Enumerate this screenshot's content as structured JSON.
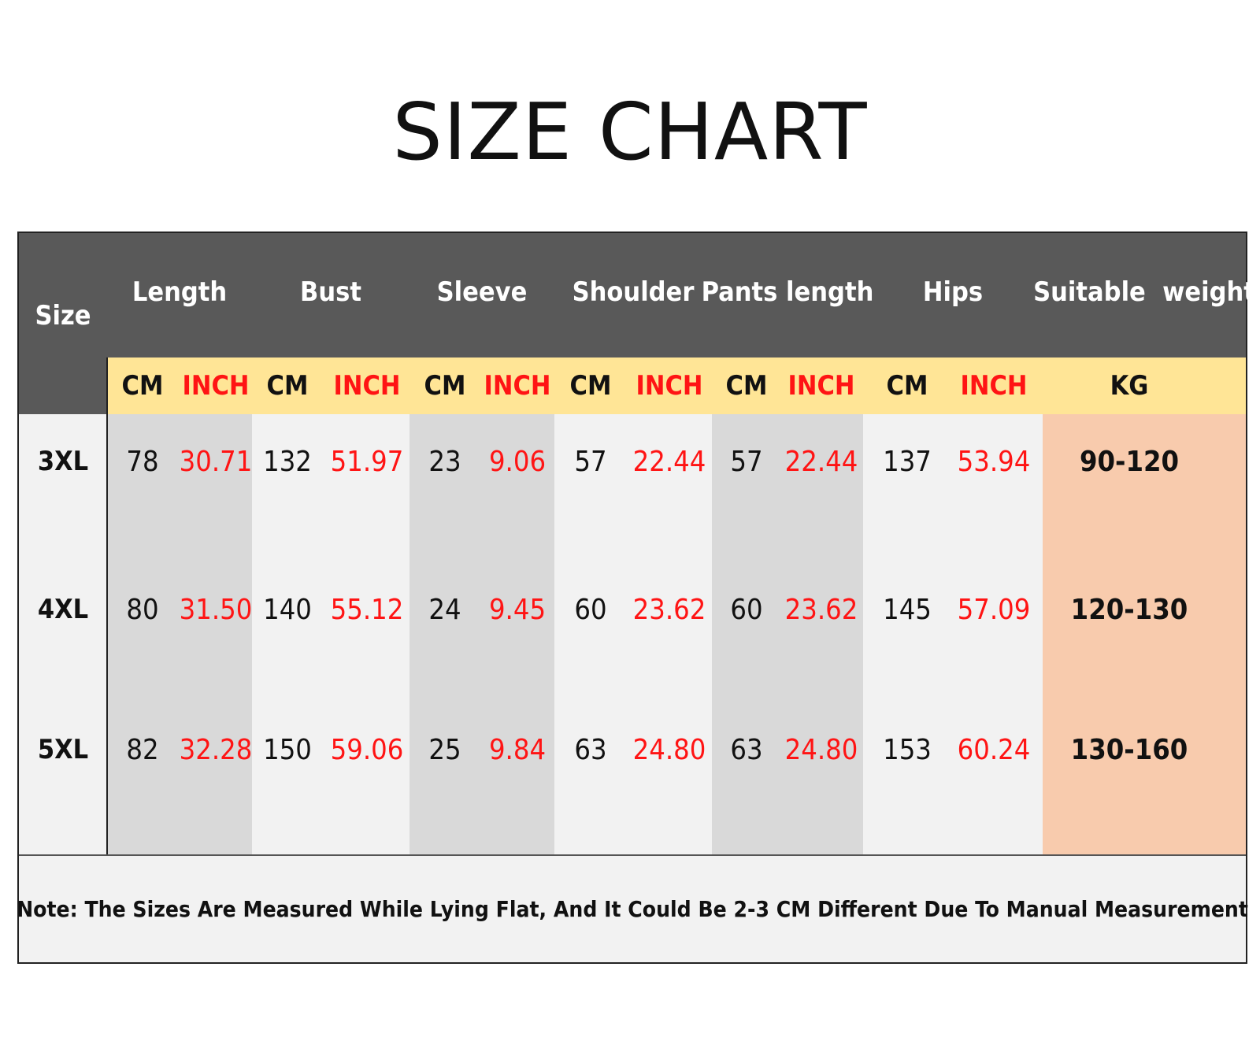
{
  "title": "SIZE CHART",
  "size_header": "Size",
  "groups": [
    "Length",
    "Bust",
    "Sleeve",
    "Shoulder",
    "Pants length",
    "Hips",
    "Suitable  weight"
  ],
  "units": [
    "CM",
    "INCH",
    "CM",
    "INCH",
    "CM",
    "INCH",
    "CM",
    "INCH",
    "CM",
    "INCH",
    "CM",
    "INCH",
    "KG"
  ],
  "rows": [
    {
      "size": "3XL",
      "values": [
        "78",
        "30.71",
        "132",
        "51.97",
        "23",
        "9.06",
        "57",
        "22.44",
        "57",
        "22.44",
        "137",
        "53.94",
        "90-120"
      ]
    },
    {
      "size": "4XL",
      "values": [
        "80",
        "31.50",
        "140",
        "55.12",
        "24",
        "9.45",
        "60",
        "23.62",
        "60",
        "23.62",
        "145",
        "57.09",
        "120-130"
      ]
    },
    {
      "size": "5XL",
      "values": [
        "82",
        "32.28",
        "150",
        "59.06",
        "25",
        "9.84",
        "63",
        "24.80",
        "63",
        "24.80",
        "153",
        "60.24",
        "130-160"
      ]
    }
  ],
  "note": "Note: The Sizes Are Measured While Lying Flat, And It Could Be 2-3 CM Different Due To Manual Measurement",
  "colors": {
    "header_dark": "#595959",
    "unit_band": "#ffe596",
    "inch_red": "#ff1414",
    "weight_col": "#f8cbad",
    "shade_col": "#d9d9d9",
    "light_col": "#f2f2f2"
  }
}
